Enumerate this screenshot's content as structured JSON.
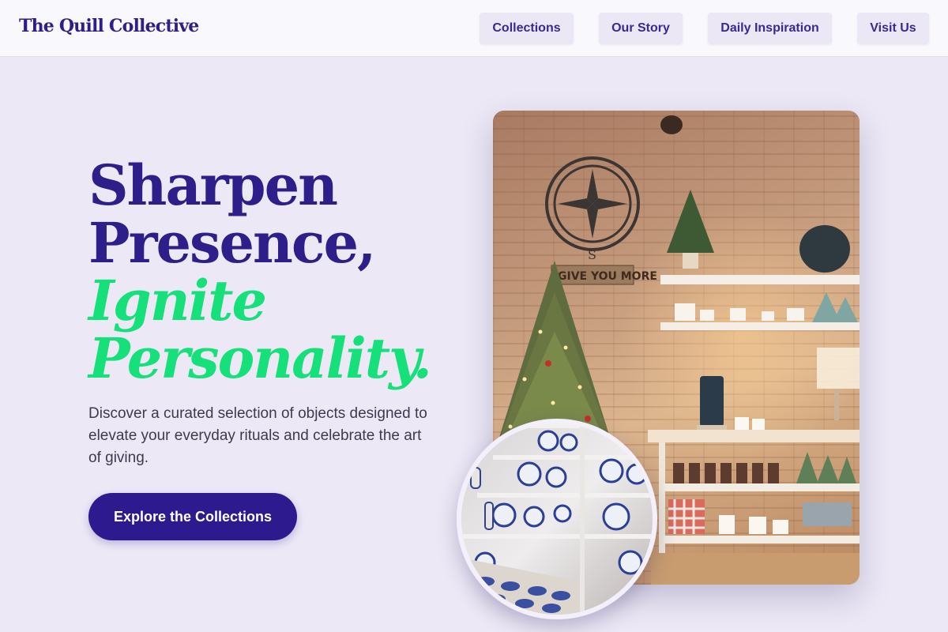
{
  "header": {
    "brand": "The Quill Collective",
    "nav": [
      {
        "label": "Collections"
      },
      {
        "label": "Our Story"
      },
      {
        "label": "Daily Inspiration"
      },
      {
        "label": "Visit Us"
      }
    ]
  },
  "hero": {
    "headline_plain": [
      "Sharpen",
      "Presence,"
    ],
    "headline_accent": [
      "Ignite",
      "Personality."
    ],
    "lede": "Discover a curated selection of objects designed to elevate your everyday rituals and celebrate the art of giving.",
    "cta_label": "Explore the Collections"
  },
  "photos": {
    "main_sign_text": "GIVE YOU MORE"
  },
  "colors": {
    "brand": "#2d1e8a",
    "accent": "#16e07a",
    "cta": "#2d1a8f",
    "background": "#ece8f6"
  }
}
